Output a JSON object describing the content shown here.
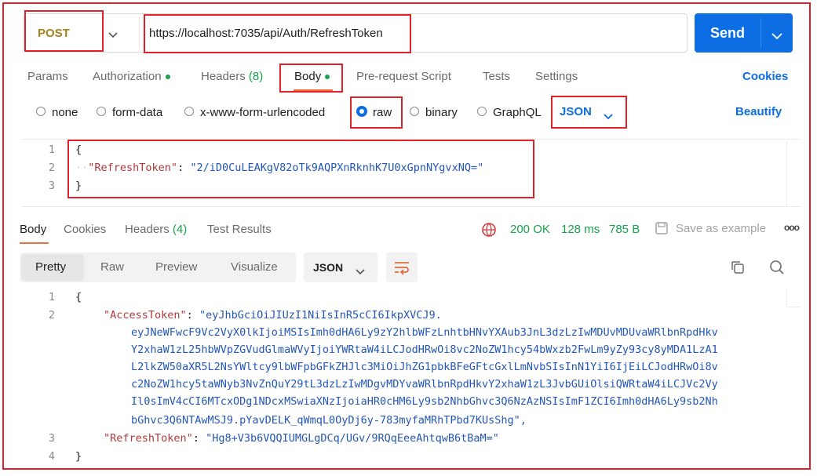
{
  "request": {
    "method": "POST",
    "url": "https://localhost:7035/api/Auth/RefreshToken",
    "send_label": "Send"
  },
  "request_tabs": {
    "params": "Params",
    "authorization": "Authorization",
    "headers": "Headers",
    "headers_count": "(8)",
    "body": "Body",
    "prerequest": "Pre-request Script",
    "tests": "Tests",
    "settings": "Settings",
    "cookies": "Cookies"
  },
  "body_modes": {
    "none": "none",
    "form_data": "form-data",
    "urlencoded": "x-www-form-urlencoded",
    "raw": "raw",
    "binary": "binary",
    "graphql": "GraphQL",
    "selected": "raw",
    "format": "JSON",
    "beautify": "Beautify"
  },
  "request_body": {
    "line_numbers": [
      "1",
      "2",
      "3"
    ],
    "open": "{",
    "key": "\"RefreshToken\"",
    "colon": ": ",
    "value": "\"2/iD0CuLEAKgV82oTk9AQPXnRknhK7U0xGpnNYgvxNQ=\"",
    "close": "}"
  },
  "response_tabs": {
    "body": "Body",
    "cookies": "Cookies",
    "headers": "Headers",
    "headers_count": "(4)",
    "test_results": "Test Results"
  },
  "response_status": {
    "code": "200 OK",
    "time": "128 ms",
    "size": "785 B",
    "save_label": "Save as example",
    "more": "ooo"
  },
  "view_tabs": {
    "pretty": "Pretty",
    "raw": "Raw",
    "preview": "Preview",
    "visualize": "Visualize",
    "format": "JSON"
  },
  "response_body": {
    "line_numbers": [
      "1",
      "2",
      "3",
      "4"
    ],
    "open": "{",
    "access_key": "\"AccessToken\"",
    "access_lines": [
      "\"eyJhbGciOiJIUzI1NiIsInR5cCI6IkpXVCJ9.",
      "eyJNeWFwcF9Vc2VyX0lkIjoiMSIsImh0dHA6Ly9zY2hlbWFzLnhtbHNvYXAub3JnL3dzLzIwMDUvMDUvaWRlbnRpdHkv",
      "Y2xhaW1zL25hbWVpZGVudGlmaWVyIjoiYWRtaW4iLCJodHRwOi8vc2NoZW1hcy54bWxzb2FwLm9yZy93cy8yMDA1LzA1",
      "L2lkZW50aXR5L2NsYWltcy9lbWFpbGFkZHJlc3MiOiJhZG1pbkBFeGFtcGxlLmNvbSIsInN1YiI6IjEiLCJodHRwOi8v",
      "c2NoZW1hcy5taWNyb3NvZnQuY29tL3dzLzIwMDgvMDYvaWRlbnRpdHkvY2xhaW1zL3JvbGUiOlsiQWRtaW4iLCJVc2Vy",
      "Il0sImV4cCI6MTcxODg1NDcxMSwiaXNzIjoiaHR0cHM6Ly9sb2NhbGhvc3Q6NzAzNSIsImF1ZCI6Imh0dHA6Ly9sb2Nh",
      "bGhvc3Q6NTAwMSJ9.pYavDELK_qWmqL0OyDj6y-783myfaMRhTPbd7KUsShg\","
    ],
    "refresh_key": "\"RefreshToken\"",
    "refresh_value": "\"Hg8+V3b6VQQIUMGLgDCq/UGv/9RQqEeeAhtqwB6tBaM=\"",
    "colon": ": ",
    "close": "}"
  },
  "colors": {
    "accent": "#0d6ee4",
    "method": "#a8811c",
    "status_ok": "#16a34a",
    "highlight_border": "#e0202a",
    "json_key": "#b03a3a",
    "json_string": "#2457b5"
  },
  "icons": [
    "chevron-down-icon",
    "globe-icon",
    "save-icon",
    "copy-icon",
    "search-icon",
    "wrap-icon"
  ]
}
